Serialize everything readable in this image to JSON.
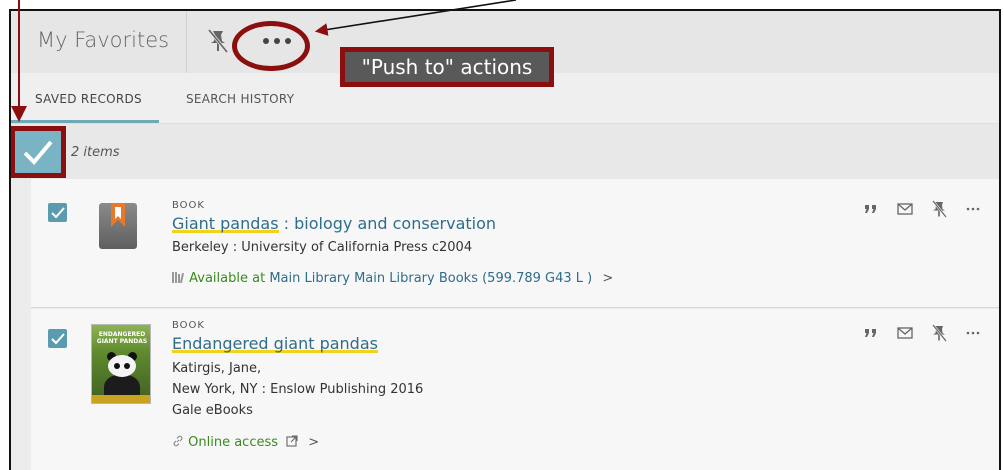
{
  "header": {
    "title": "My Favorites",
    "pin_icon": "unpin-icon",
    "more_icon": "more-options-icon"
  },
  "annotation": {
    "label": "\"Push to\" actions"
  },
  "tabs": [
    {
      "label": "SAVED RECORDS",
      "active": true
    },
    {
      "label": "SEARCH HISTORY",
      "active": false
    }
  ],
  "toolbar": {
    "count_label": "2 items",
    "select_all_checked": true
  },
  "records": [
    {
      "type": "BOOK",
      "title_main": "Giant pandas",
      "title_rest": " : biology and conservation",
      "publisher": "Berkeley : University of California Press c2004",
      "availability_status": "Available at",
      "availability_location": "Main Library  Main Library Books (599.789 G43 L )",
      "chevron": ">",
      "checked": true,
      "thumbnail": "book-generic-icon"
    },
    {
      "type": "BOOK",
      "title_main": "Endangered giant pandas",
      "author": "Katirgis, Jane,",
      "publisher": "New York, NY : Enslow Publishing 2016",
      "source": "Gale eBooks",
      "access_label": "Online access",
      "chevron": ">",
      "checked": true,
      "thumbnail": "book-cover-image",
      "cover_text": "ENDANGERED GIANT PANDAS"
    }
  ],
  "colors": {
    "accent": "#5b9bb0",
    "link": "#2f6d8a",
    "annotation_red": "#8b0f0f",
    "available_green": "#3a8a1f",
    "highlight": "#f2d21b"
  }
}
